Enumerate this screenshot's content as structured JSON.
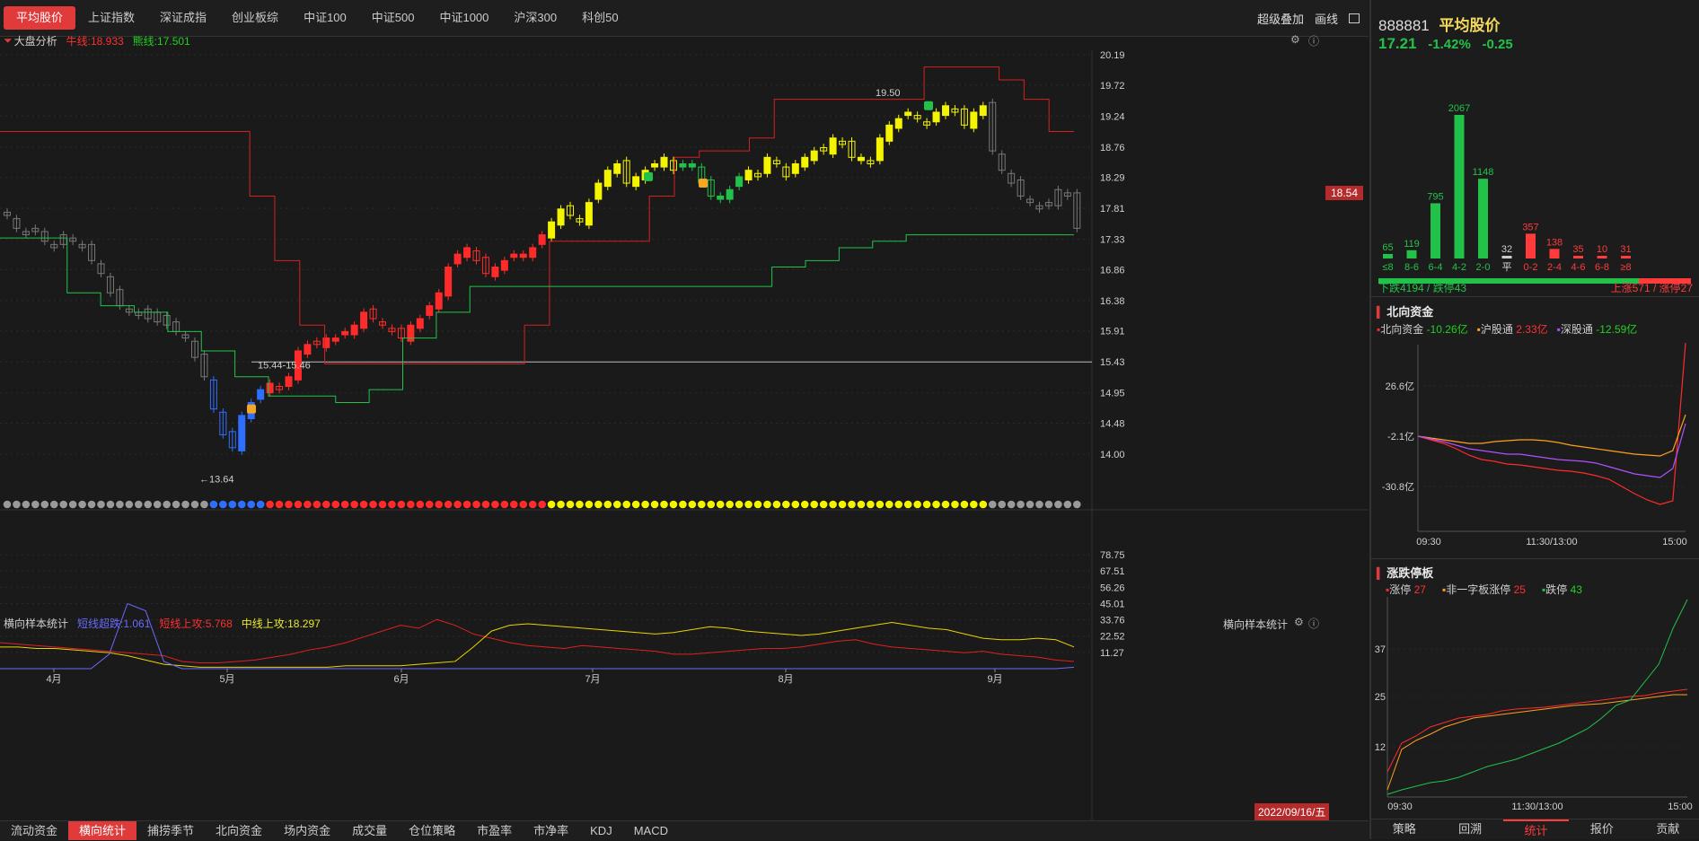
{
  "top_tabs": [
    "平均股价",
    "上证指数",
    "深证成指",
    "创业板综",
    "中证100",
    "中证500",
    "中证1000",
    "沪深300",
    "科创50"
  ],
  "tools": {
    "overlay": "超级叠加",
    "draw": "画线"
  },
  "main_legend": {
    "title": "大盘分析",
    "bull_label": "牛线:18.933",
    "bear_label": "熊线:17.501"
  },
  "price_axis": [
    "20.19",
    "19.72",
    "19.24",
    "18.76",
    "18.29",
    "17.81",
    "17.33",
    "16.86",
    "16.38",
    "15.91",
    "15.43",
    "14.95",
    "14.48",
    "14.00"
  ],
  "current_price_tag": "18.54",
  "annotations": {
    "high": "19.50",
    "low": "13.64",
    "range": "15.44-15.46"
  },
  "sub_legend": {
    "title": "横向样本统计",
    "short_oversold": "短线超跌:1.061",
    "short_up": "短线上攻:5.768",
    "mid_up": "中线上攻:18.297",
    "right_title": "横向样本统计"
  },
  "sub_axis": [
    "78.75",
    "67.51",
    "56.26",
    "45.01",
    "33.76",
    "22.52",
    "11.27"
  ],
  "x_axis": [
    "4月",
    "5月",
    "6月",
    "7月",
    "8月",
    "9月"
  ],
  "date_badge": "2022/09/16/五",
  "bottom_tabs": [
    "流动资金",
    "横向统计",
    "捕捞季节",
    "北向资金",
    "场内资金",
    "成交量",
    "仓位策略",
    "市盈率",
    "市净率",
    "KDJ",
    "MACD"
  ],
  "active_bottom_tab": "横向统计",
  "stock": {
    "code": "888881",
    "name": "平均股价",
    "price": "17.21",
    "pct": "-1.42%",
    "change": "-0.25"
  },
  "distribution": {
    "labels": [
      "≤8",
      "8-6",
      "6-4",
      "4-2",
      "2-0",
      "平",
      "0-2",
      "2-4",
      "4-6",
      "6-8",
      "≥8"
    ],
    "values": [
      65,
      119,
      795,
      2067,
      1148,
      32,
      357,
      138,
      35,
      10,
      31
    ],
    "down_text": "下跌4194 / 跌停43",
    "up_text": "上涨571 / 涨停27"
  },
  "north": {
    "title": "北向资金",
    "items": [
      {
        "label": "北向资金",
        "value": "-10.26亿"
      },
      {
        "label": "沪股通",
        "value": "2.33亿"
      },
      {
        "label": "深股通",
        "value": "-12.59亿"
      }
    ],
    "yaxis": [
      "26.6亿",
      "-2.1亿",
      "-30.8亿"
    ],
    "xaxis": [
      "09:30",
      "11:30/13:00",
      "15:00"
    ]
  },
  "limit": {
    "title": "涨跌停板",
    "items": [
      {
        "label": "涨停",
        "value": "27"
      },
      {
        "label": "非一字板涨停",
        "value": "25"
      },
      {
        "label": "跌停",
        "value": "43"
      }
    ],
    "yaxis": [
      "37",
      "25",
      "12"
    ],
    "xaxis": [
      "09:30",
      "11:30/13:00",
      "15:00"
    ]
  },
  "right_tabs": [
    "策略",
    "回溯",
    "统计",
    "报价",
    "贡献"
  ],
  "active_right_tab": "统计",
  "colors": {
    "up": "#ff2b2b",
    "down": "#22c24a",
    "yellow": "#f4f400",
    "blue": "#2f6fff"
  }
}
